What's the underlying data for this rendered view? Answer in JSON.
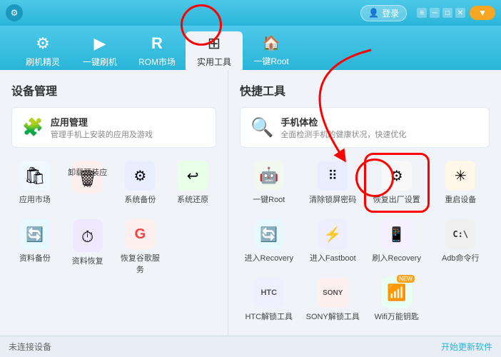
{
  "titlebar": {
    "login_label": "登录",
    "download_label": "▼",
    "min_label": "─",
    "max_label": "□",
    "close_label": "✕"
  },
  "nav": {
    "items": [
      {
        "id": "flash-expert",
        "label": "刷机精灵",
        "icon": "⚙",
        "active": false
      },
      {
        "id": "one-click-flash",
        "label": "一键刷机",
        "icon": "▶",
        "active": false
      },
      {
        "id": "rom-market",
        "label": "ROM市场",
        "icon": "®",
        "active": false
      },
      {
        "id": "practical-tools",
        "label": "实用工具",
        "icon": "⊞",
        "active": true
      },
      {
        "id": "one-click-root",
        "label": "一键Root",
        "icon": "▲",
        "active": false
      }
    ]
  },
  "left": {
    "section_title": "设备管理",
    "app_mgmt": {
      "title": "应用管理",
      "desc": "管理手机上安装的应用及游戏"
    },
    "icons": [
      {
        "id": "appstore",
        "label": "应用市场",
        "icon": "🛍"
      },
      {
        "id": "uninstall",
        "label": "卸载预装应用",
        "icon": "🗑"
      },
      {
        "id": "backup",
        "label": "系统备份",
        "icon": "⚙"
      },
      {
        "id": "restore",
        "label": "系统还原",
        "icon": "↩"
      },
      {
        "id": "datasave",
        "label": "资料备份",
        "icon": "🔄"
      },
      {
        "id": "datarestore",
        "label": "资料恢复",
        "icon": "⏱"
      },
      {
        "id": "google",
        "label": "恢复谷歌服务",
        "icon": "G"
      }
    ]
  },
  "right": {
    "section_title": "快捷工具",
    "health": {
      "title": "手机体检",
      "desc": "全面检测手机的健康状况，快速优化"
    },
    "icons": [
      {
        "id": "one-root",
        "label": "一键Root",
        "icon": "🤖",
        "highlighted": false
      },
      {
        "id": "lockscreen",
        "label": "清除锁屏密码",
        "icon": "⠿",
        "highlighted": false
      },
      {
        "id": "factory-reset",
        "label": "恢复出厂设置",
        "icon": "⚙",
        "highlighted": true
      },
      {
        "id": "reboot",
        "label": "重启设备",
        "icon": "✳",
        "highlighted": false
      },
      {
        "id": "enter-recovery",
        "label": "进入Recovery",
        "icon": "🔄",
        "highlighted": false
      },
      {
        "id": "enter-fastboot",
        "label": "进入Fastboot",
        "icon": "⚡",
        "highlighted": false
      },
      {
        "id": "flash-recovery",
        "label": "刷入Recovery",
        "icon": "📱",
        "highlighted": false
      },
      {
        "id": "adb-cmd",
        "label": "Adb命令行",
        "icon": "C:\\",
        "highlighted": false
      },
      {
        "id": "htc-unlock",
        "label": "HTC解锁工具",
        "icon": "HTC",
        "highlighted": false
      },
      {
        "id": "sony-unlock",
        "label": "SONY解锁工具",
        "icon": "SONY",
        "highlighted": false
      },
      {
        "id": "wifi-key",
        "label": "Wifi万能钥匙",
        "icon": "📶",
        "highlighted": false,
        "new": true
      }
    ]
  },
  "statusbar": {
    "device_status": "未连接设备",
    "action_label": "开始更新软件"
  }
}
